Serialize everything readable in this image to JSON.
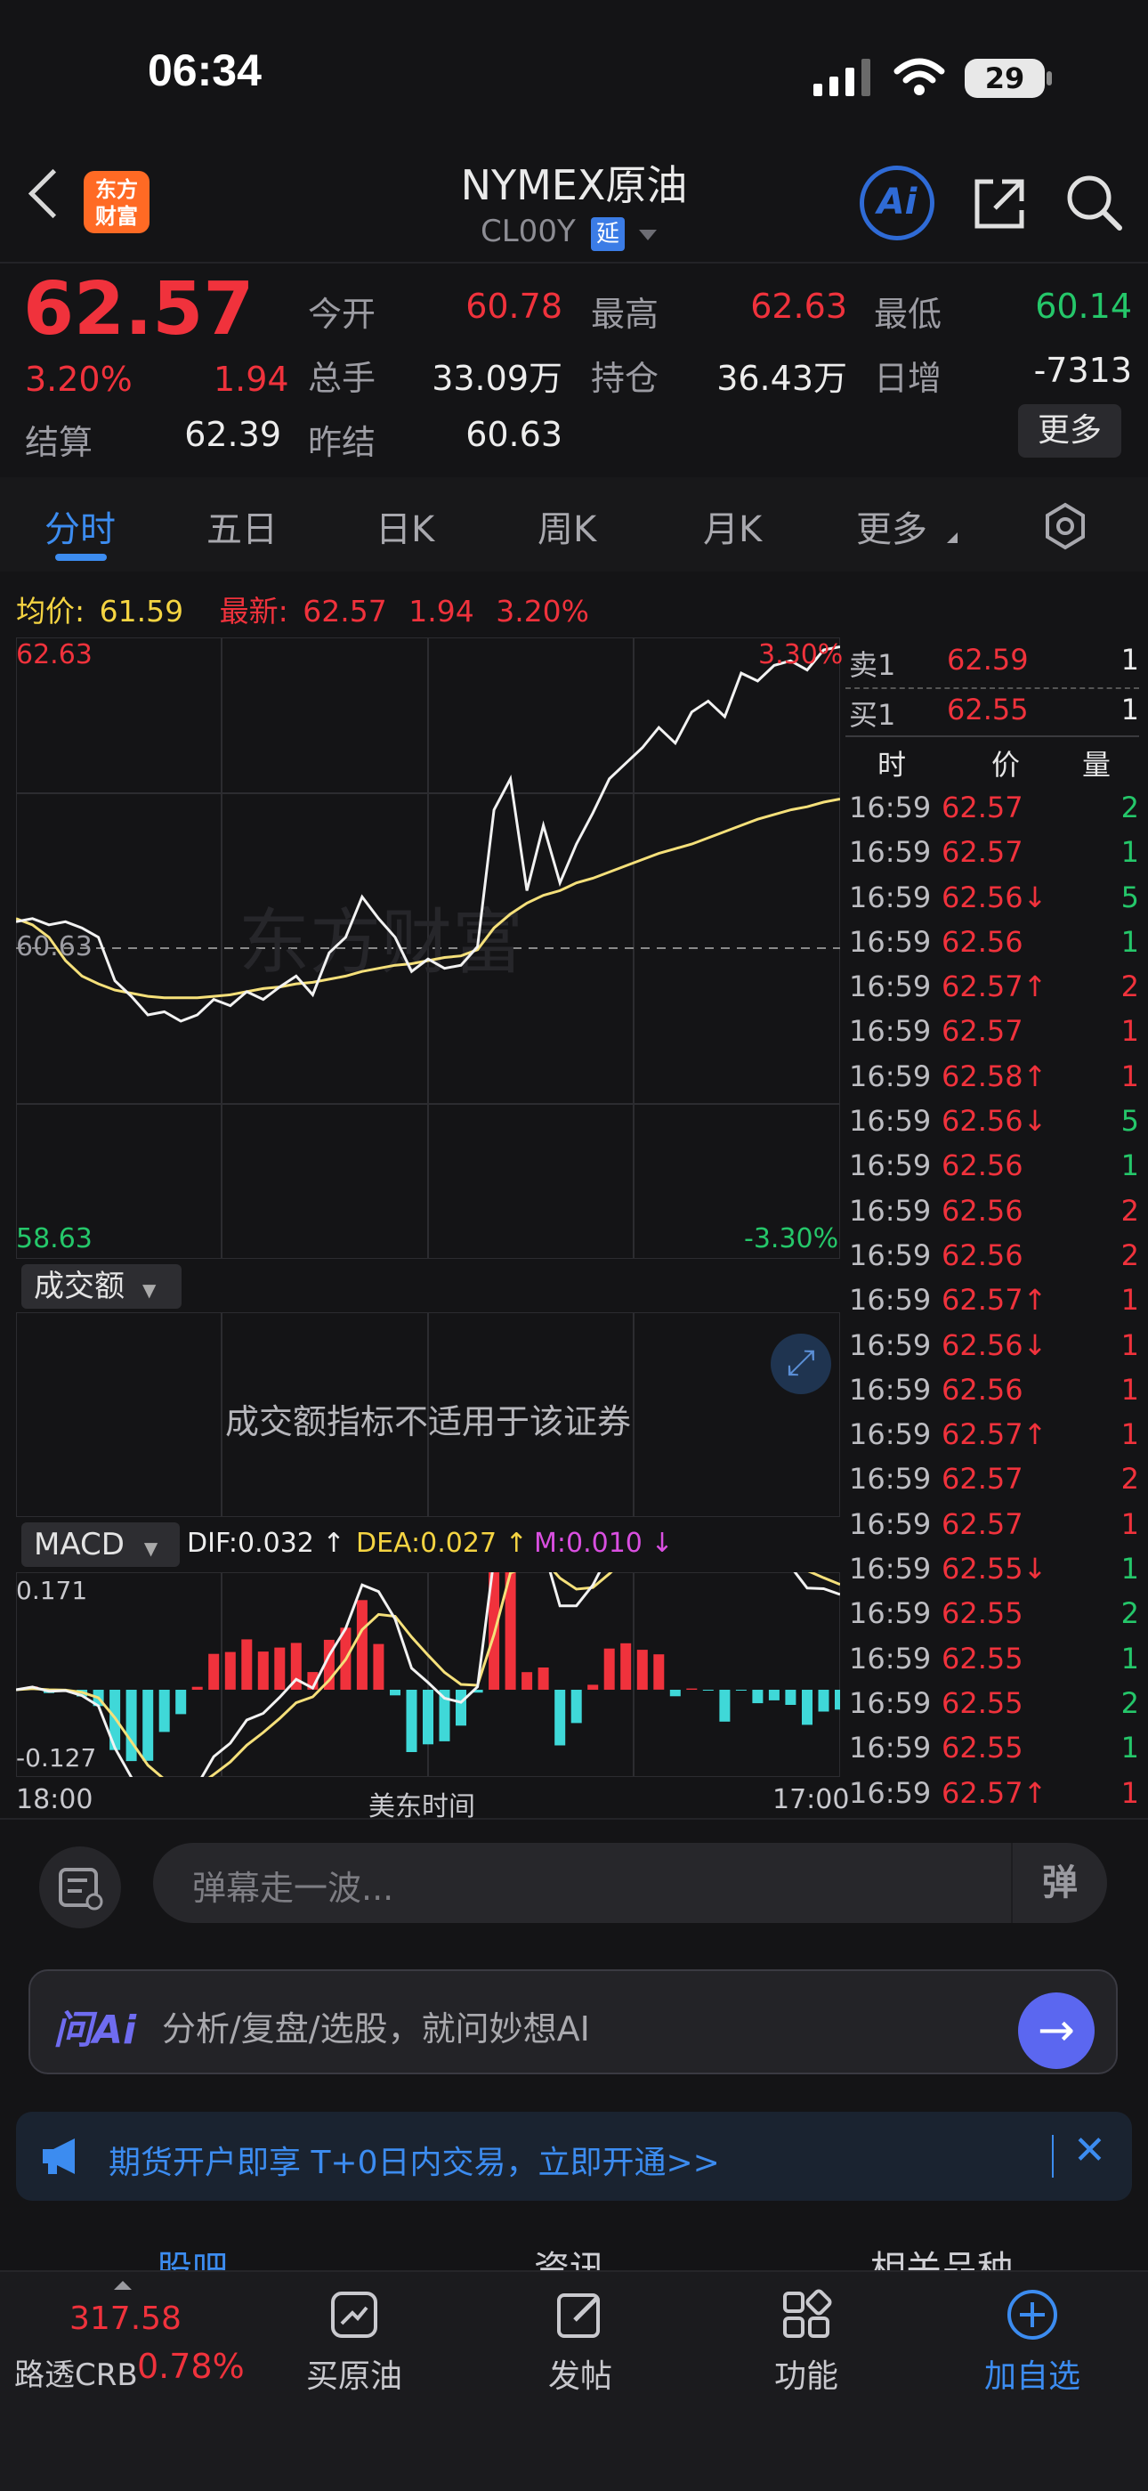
{
  "status_bar": {
    "time": "06:34",
    "battery": "29"
  },
  "header": {
    "title": "NYMEX原油",
    "code": "CL00Y",
    "badge": "延",
    "logo_line1": "东方",
    "logo_line2": "财富",
    "ai_label": "Ai"
  },
  "quote": {
    "price": "62.57",
    "change_pct": "3.20%",
    "change": "1.94",
    "settle_label": "结算",
    "settle": "62.39",
    "open_label": "今开",
    "open": "60.78",
    "high_label": "最高",
    "high": "62.63",
    "low_label": "最低",
    "low": "60.14",
    "volume_label": "总手",
    "volume": "33.09万",
    "oi_label": "持仓",
    "oi": "36.43万",
    "daily_inc_label": "日增",
    "daily_inc": "-7313",
    "prev_settle_label": "昨结",
    "prev_settle": "60.63",
    "more_label": "更多"
  },
  "tabs": [
    "分时",
    "五日",
    "日K",
    "周K",
    "月K",
    "更多"
  ],
  "avg_line": {
    "avg_label": "均价:",
    "avg": "61.59",
    "latest_label": "最新:",
    "latest": "62.57",
    "chg": "1.94",
    "pct": "3.20%"
  },
  "chart": {
    "y_top": "62.63",
    "y_mid": "60.63",
    "y_bottom": "58.63",
    "pct_top": "3.30%",
    "pct_bottom": "-3.30%",
    "watermark": "东方财富",
    "volume_selector": "成交额",
    "volume_msg": "成交额指标不适用于该证券",
    "macd_selector": "MACD",
    "dif": "DIF:0.032 ↑",
    "dea": "DEA:0.027 ↑",
    "m": "M:0.010 ↓",
    "macd_top": "0.171",
    "macd_bottom": "-0.127",
    "x_start": "18:00",
    "x_mid": "美东时间",
    "x_end": "17:00"
  },
  "chart_data": {
    "type": "line",
    "title": "",
    "y_range": [
      58.63,
      62.63
    ],
    "prev_close": 60.63,
    "series": [
      {
        "name": "",
        "values": [
          60.8,
          60.82,
          60.78,
          60.8,
          60.76,
          60.7,
          60.42,
          60.32,
          60.2,
          60.22,
          60.16,
          60.2,
          60.3,
          60.26,
          60.35,
          60.3,
          60.38,
          60.45,
          60.33,
          60.6,
          60.7,
          60.96,
          60.82,
          60.7,
          60.48,
          60.56,
          60.5,
          60.52,
          60.64,
          61.52,
          61.72,
          61.0,
          61.42,
          61.05,
          61.3,
          61.5,
          61.72,
          61.82,
          61.92,
          62.05,
          61.95,
          62.15,
          62.22,
          62.12,
          62.4,
          62.35,
          62.45,
          62.48,
          62.42,
          62.55,
          62.57
        ]
      },
      {
        "name": "",
        "values": [
          60.82,
          60.78,
          60.7,
          60.55,
          60.45,
          60.4,
          60.36,
          60.34,
          60.32,
          60.31,
          60.31,
          60.31,
          60.32,
          60.33,
          60.35,
          60.37,
          60.38,
          60.4,
          60.41,
          60.43,
          60.45,
          60.48,
          60.5,
          60.52,
          60.53,
          60.55,
          60.57,
          60.58,
          60.62,
          60.76,
          60.85,
          60.92,
          60.97,
          61.0,
          61.05,
          61.08,
          61.12,
          61.16,
          61.2,
          61.24,
          61.27,
          61.3,
          61.34,
          61.38,
          61.42,
          61.46,
          61.49,
          61.52,
          61.54,
          61.57,
          61.59
        ]
      }
    ]
  },
  "order_book": {
    "ask_label": "卖1",
    "ask_price": "62.59",
    "ask_vol": "1",
    "bid_label": "买1",
    "bid_price": "62.55",
    "bid_vol": "1",
    "h_time": "时",
    "h_price": "价",
    "h_vol": "量"
  },
  "trades": [
    {
      "t": "16:59",
      "p": "62.57",
      "v": "2",
      "pc": "red",
      "vc": "green"
    },
    {
      "t": "16:59",
      "p": "62.57",
      "v": "1",
      "pc": "red",
      "vc": "green"
    },
    {
      "t": "16:59",
      "p": "62.56↓",
      "v": "5",
      "pc": "red",
      "vc": "green"
    },
    {
      "t": "16:59",
      "p": "62.56",
      "v": "1",
      "pc": "red",
      "vc": "green"
    },
    {
      "t": "16:59",
      "p": "62.57↑",
      "v": "2",
      "pc": "red",
      "vc": "red"
    },
    {
      "t": "16:59",
      "p": "62.57",
      "v": "1",
      "pc": "red",
      "vc": "red"
    },
    {
      "t": "16:59",
      "p": "62.58↑",
      "v": "1",
      "pc": "red",
      "vc": "red"
    },
    {
      "t": "16:59",
      "p": "62.56↓",
      "v": "5",
      "pc": "red",
      "vc": "green"
    },
    {
      "t": "16:59",
      "p": "62.56",
      "v": "1",
      "pc": "red",
      "vc": "green"
    },
    {
      "t": "16:59",
      "p": "62.56",
      "v": "2",
      "pc": "red",
      "vc": "red"
    },
    {
      "t": "16:59",
      "p": "62.56",
      "v": "2",
      "pc": "red",
      "vc": "red"
    },
    {
      "t": "16:59",
      "p": "62.57↑",
      "v": "1",
      "pc": "red",
      "vc": "red"
    },
    {
      "t": "16:59",
      "p": "62.56↓",
      "v": "1",
      "pc": "red",
      "vc": "red"
    },
    {
      "t": "16:59",
      "p": "62.56",
      "v": "1",
      "pc": "red",
      "vc": "red"
    },
    {
      "t": "16:59",
      "p": "62.57↑",
      "v": "1",
      "pc": "red",
      "vc": "red"
    },
    {
      "t": "16:59",
      "p": "62.57",
      "v": "2",
      "pc": "red",
      "vc": "red"
    },
    {
      "t": "16:59",
      "p": "62.57",
      "v": "1",
      "pc": "red",
      "vc": "red"
    },
    {
      "t": "16:59",
      "p": "62.55↓",
      "v": "1",
      "pc": "red",
      "vc": "green"
    },
    {
      "t": "16:59",
      "p": "62.55",
      "v": "2",
      "pc": "red",
      "vc": "green"
    },
    {
      "t": "16:59",
      "p": "62.55",
      "v": "1",
      "pc": "red",
      "vc": "green"
    },
    {
      "t": "16:59",
      "p": "62.55",
      "v": "2",
      "pc": "red",
      "vc": "green"
    },
    {
      "t": "16:59",
      "p": "62.55",
      "v": "1",
      "pc": "red",
      "vc": "green"
    },
    {
      "t": "16:59",
      "p": "62.57↑",
      "v": "1",
      "pc": "red",
      "vc": "red"
    }
  ],
  "danmu": {
    "placeholder": "弹幕走一波...",
    "send": "弹"
  },
  "ai_bar": {
    "brand": "问Ai",
    "placeholder": "分析/复盘/选股，就问妙想AI"
  },
  "notice": {
    "text": "期货开户即享 T+0日内交易，立即开通>>"
  },
  "sub_tabs": [
    "股吧",
    "资讯",
    "相关品种"
  ],
  "bottom_nav": {
    "index_value": "317.58",
    "index_name": "路透CRB",
    "index_pct": "0.78%",
    "items": [
      "买原油",
      "发帖",
      "功能",
      "加自选"
    ]
  },
  "colors": {
    "up": "#f0323c",
    "down": "#25c76a",
    "accent": "#3c8cf0",
    "avg_line": "#f5e07a"
  }
}
